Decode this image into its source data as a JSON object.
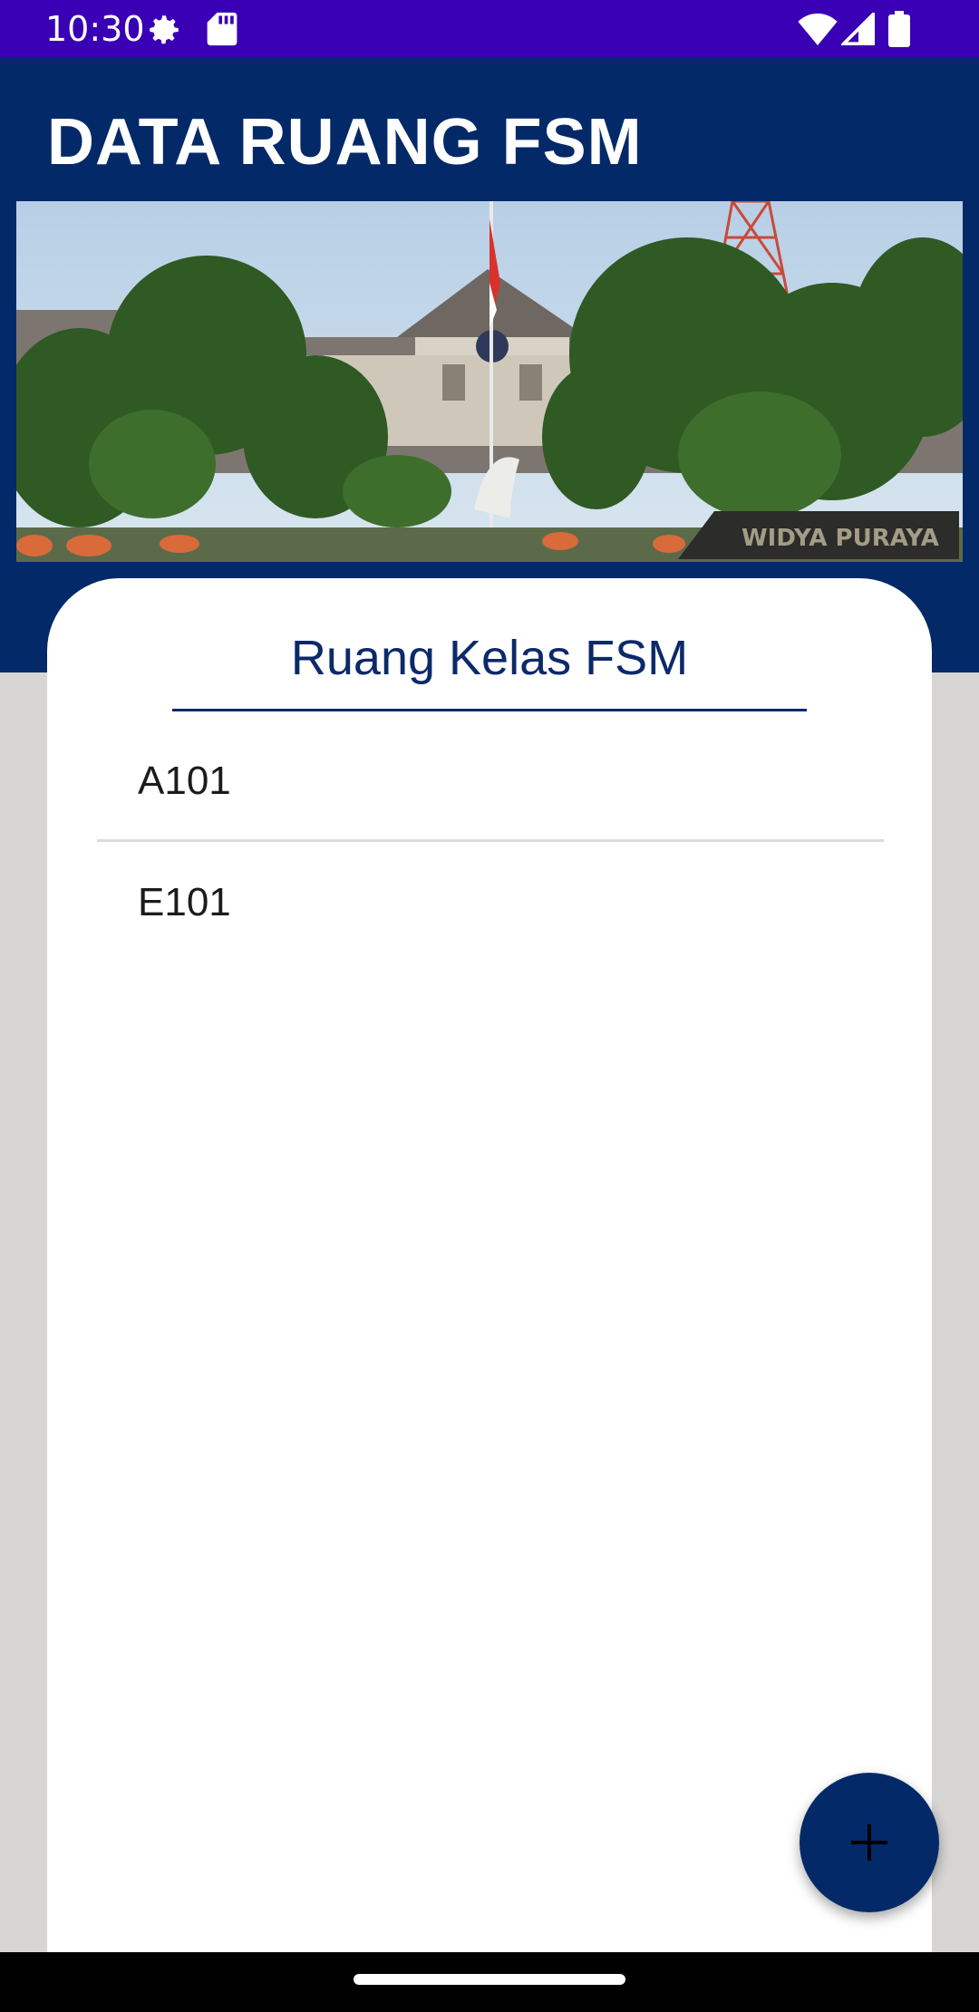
{
  "status_bar": {
    "time": "10:30",
    "icons": [
      "settings-icon",
      "sd-card-icon",
      "wifi-icon",
      "signal-icon",
      "battery-icon"
    ],
    "background": "#3a00b5"
  },
  "header": {
    "title": "DATA RUANG FSM",
    "background": "#032968",
    "photo_sign_text": "WIDYA PURAYA"
  },
  "main": {
    "section_title": "Ruang Kelas FSM",
    "rooms": [
      {
        "name": "A101"
      },
      {
        "name": "E101"
      }
    ],
    "accent": "#0c2a6a"
  },
  "fab": {
    "icon": "plus-icon",
    "color": "#032968"
  }
}
